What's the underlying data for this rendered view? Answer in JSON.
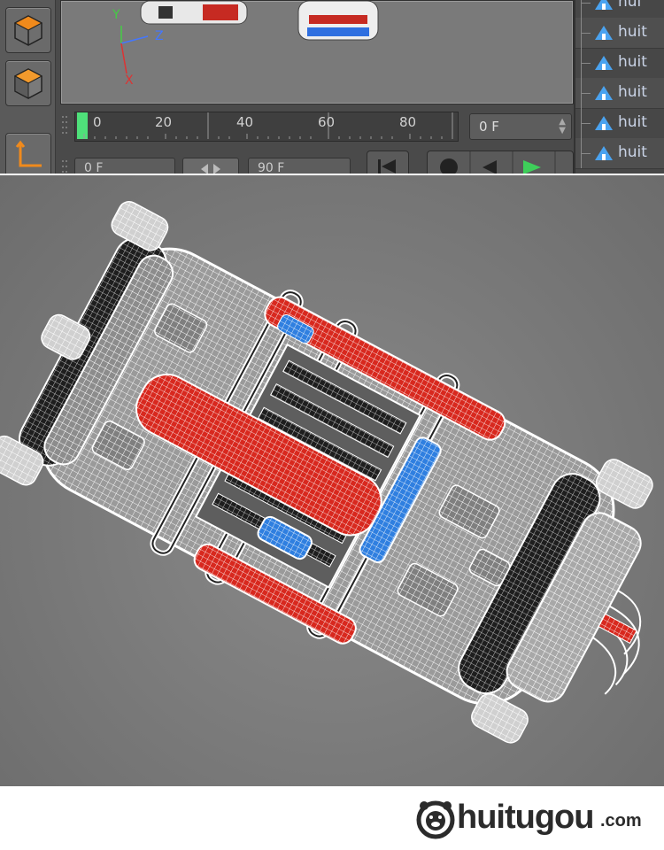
{
  "viewport_axes": {
    "y": "Y",
    "z": "Z",
    "x": "X"
  },
  "timeline": {
    "ticks": [
      "0",
      "20",
      "40",
      "60",
      "80"
    ],
    "current_frame": "0 F",
    "start_field": "0 F",
    "end_field": "90 F"
  },
  "object_manager": {
    "items": [
      {
        "label": "hui"
      },
      {
        "label": "huit"
      },
      {
        "label": "huit"
      },
      {
        "label": "huit"
      },
      {
        "label": "huit"
      },
      {
        "label": "huit"
      }
    ]
  },
  "watermark": {
    "word": "huitugou",
    "tld": ".com"
  },
  "colors": {
    "accent_orange": "#f08a1c",
    "playhead": "#4fe07a",
    "axis_y": "#44cc44",
    "axis_z": "#4477ff",
    "axis_x": "#dd3333",
    "wire_red": "#d8281e",
    "wire_blue": "#2f7fe0"
  }
}
